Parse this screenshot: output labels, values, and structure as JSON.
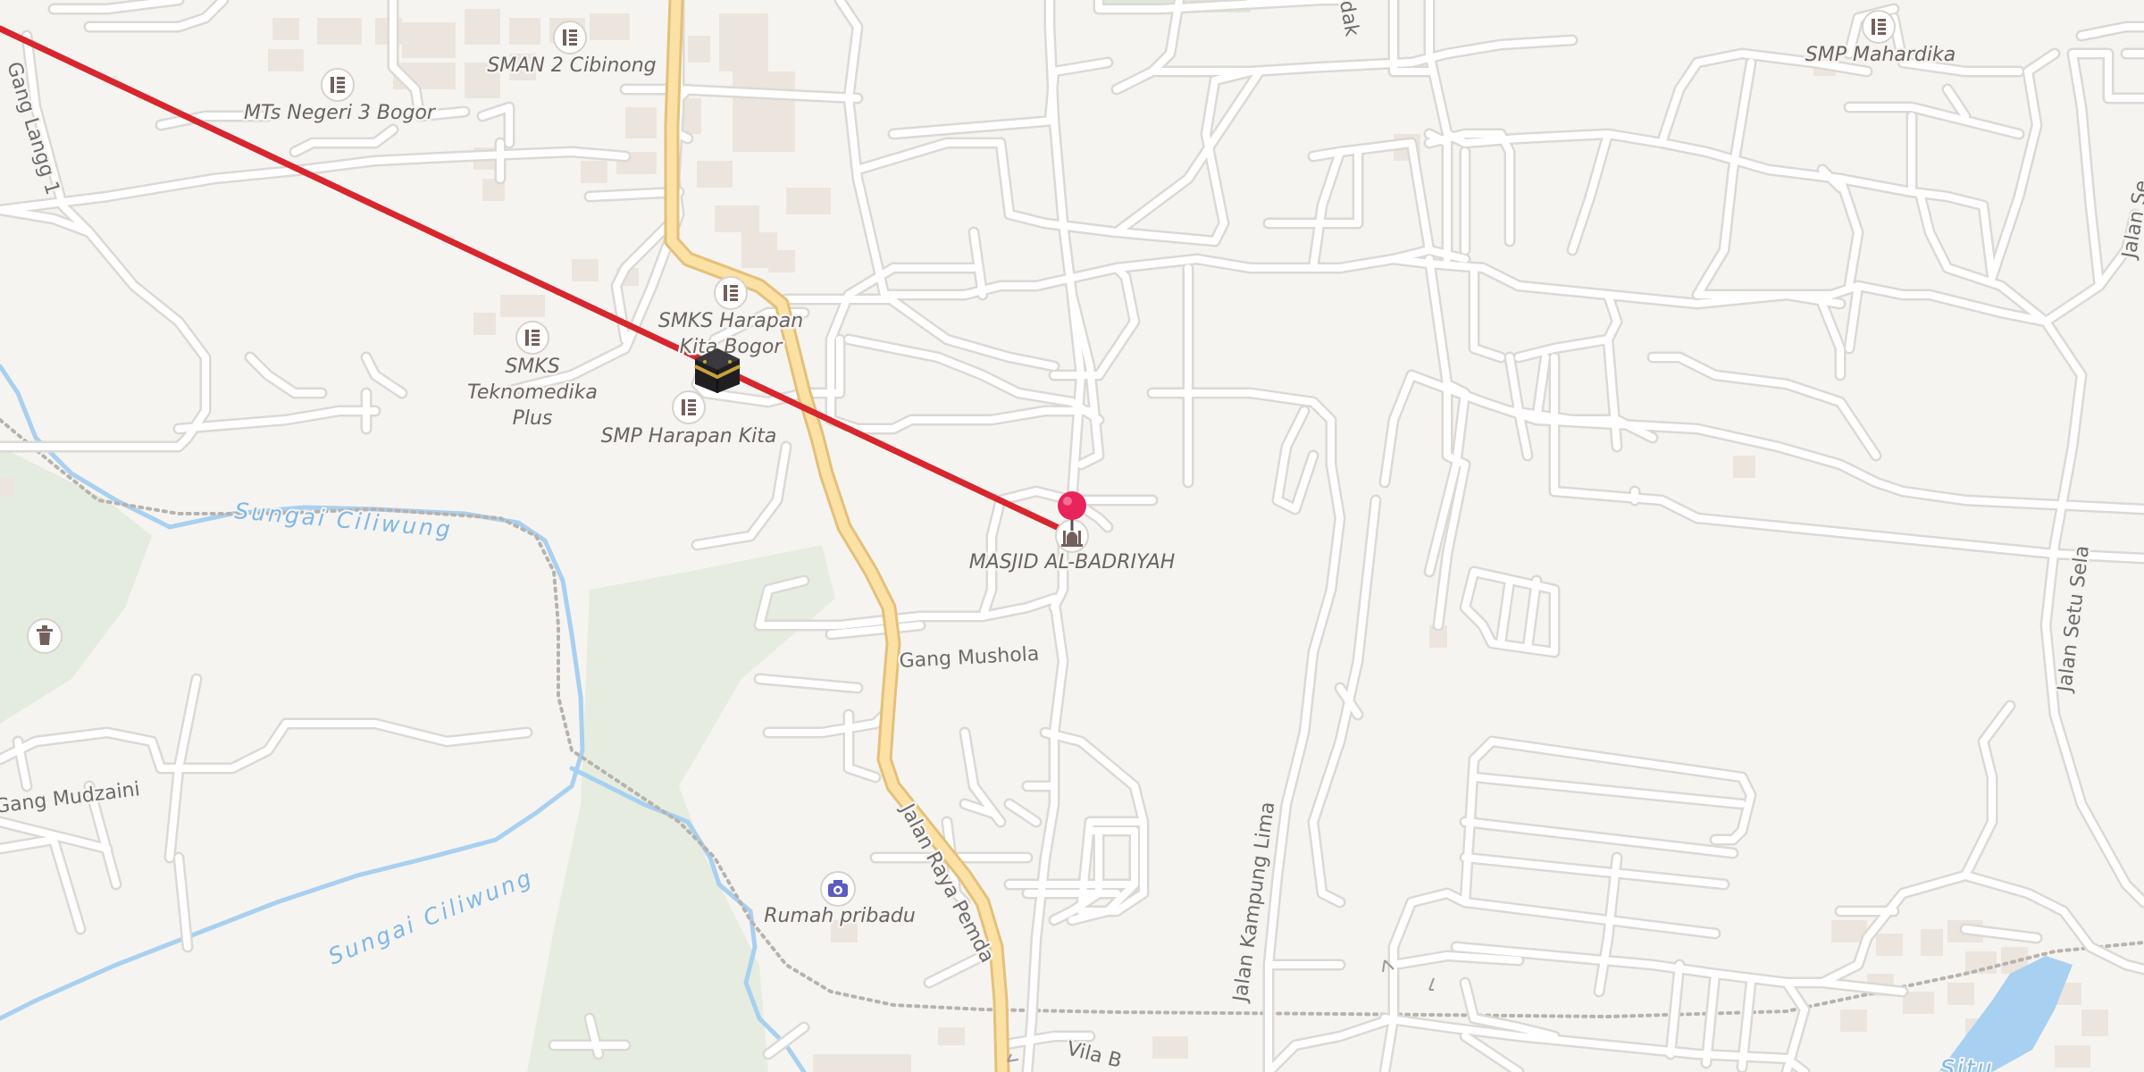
{
  "poi_labels": {
    "sman2": "SMAN 2 Cibinong",
    "mts3": "MTs Negeri 3 Bogor",
    "smp_mahardika": "SMP Mahardika",
    "smks_harapan_1": "SMKS Harapan",
    "smks_harapan_2": "Kita Bogor",
    "smks_tekno_1": "SMKS",
    "smks_tekno_2": "Teknomedika",
    "smks_tekno_3": "Plus",
    "smp_harapan": "SMP Harapan Kita",
    "masjid": "MASJID AL-BADRIYAH",
    "rumah": "Rumah pribadu"
  },
  "street_labels": {
    "gang_langg": "Gang Langg 1",
    "gang_mushola": "Gang Mushola",
    "gang_mudzaini": "Gang Mudzaini",
    "jalan_raya_pemda": "Jalan Raya Pemda",
    "jalan_kampung_lima": "Jalan Kampung Lima",
    "jalan_setu_sela": "Jalan Setu Sela",
    "jalan_se": "Jalan Se",
    "vila_b": "Vila B",
    "dak": "dak",
    "situ": "Situ"
  },
  "water_labels": {
    "river_1": "Sungai Ciliwung",
    "river_2": "Sungai Ciliwung"
  },
  "colors": {
    "background": "#f6f4f1",
    "road": "#ffffff",
    "road_casing": "#dcd9d4",
    "main_road": "#fbe1a4",
    "main_road_casing": "#e4c07a",
    "water": "#a8d0f0",
    "park": "#e4ebdf",
    "building": "#ebe5de",
    "qibla_line": "#d7262d",
    "pin": "#e8245a",
    "poi_icon": "#74605a",
    "camera_icon": "#5b5bc0"
  },
  "icons": {
    "school": "school-icon",
    "mosque": "mosque-icon",
    "kaaba": "kaaba-icon",
    "camera": "camera-icon",
    "pin": "location-pin-icon",
    "monument": "monument-icon"
  }
}
